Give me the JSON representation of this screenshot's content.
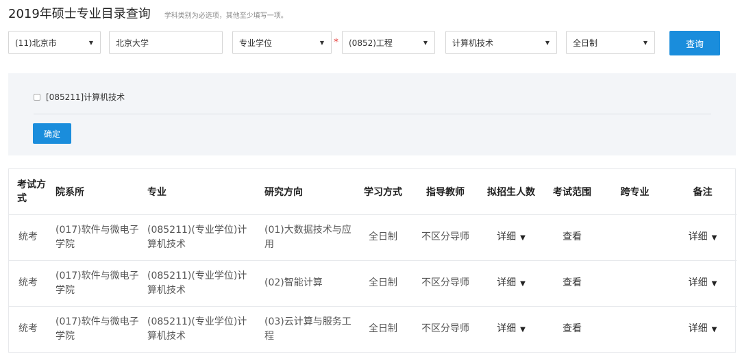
{
  "header": {
    "title": "2019年硕士专业目录查询",
    "hint": "学科类别为必选项，其他至少填写一项。"
  },
  "filters": {
    "province": "(11)北京市",
    "university": "北京大学",
    "degree_type": "专业学位",
    "required_mark": "*",
    "discipline": "(0852)工程",
    "field": "计算机技术",
    "study_mode": "全日制",
    "query_label": "查询"
  },
  "panel": {
    "checkbox_label": "[085211]计算机技术",
    "confirm_label": "确定"
  },
  "table": {
    "headers": [
      "考试方式",
      "院系所",
      "专业",
      "研究方向",
      "学习方式",
      "指导教师",
      "拟招生人数",
      "考试范围",
      "跨专业",
      "备注"
    ],
    "rows": [
      {
        "exam": "统考",
        "dept": "(017)软件与微电子学院",
        "major": "(085211)(专业学位)计算机技术",
        "direction": "(01)大数据技术与应用",
        "mode": "全日制",
        "advisor": "不区分导师",
        "quota": "详细",
        "scope": "查看",
        "cross": "",
        "notes": "详细"
      },
      {
        "exam": "统考",
        "dept": "(017)软件与微电子学院",
        "major": "(085211)(专业学位)计算机技术",
        "direction": "(02)智能计算",
        "mode": "全日制",
        "advisor": "不区分导师",
        "quota": "详细",
        "scope": "查看",
        "cross": "",
        "notes": "详细"
      },
      {
        "exam": "统考",
        "dept": "(017)软件与微电子学院",
        "major": "(085211)(专业学位)计算机技术",
        "direction": "(03)云计算与服务工程",
        "mode": "全日制",
        "advisor": "不区分导师",
        "quota": "详细",
        "scope": "查看",
        "cross": "",
        "notes": "详细"
      }
    ]
  },
  "icons": {
    "caret": "caret-down-icon",
    "dropdown_arrow": "triangle-down-icon"
  },
  "colors": {
    "primary": "#1a8ddc",
    "required": "#e64340",
    "panel_bg": "#f3f5f8"
  }
}
